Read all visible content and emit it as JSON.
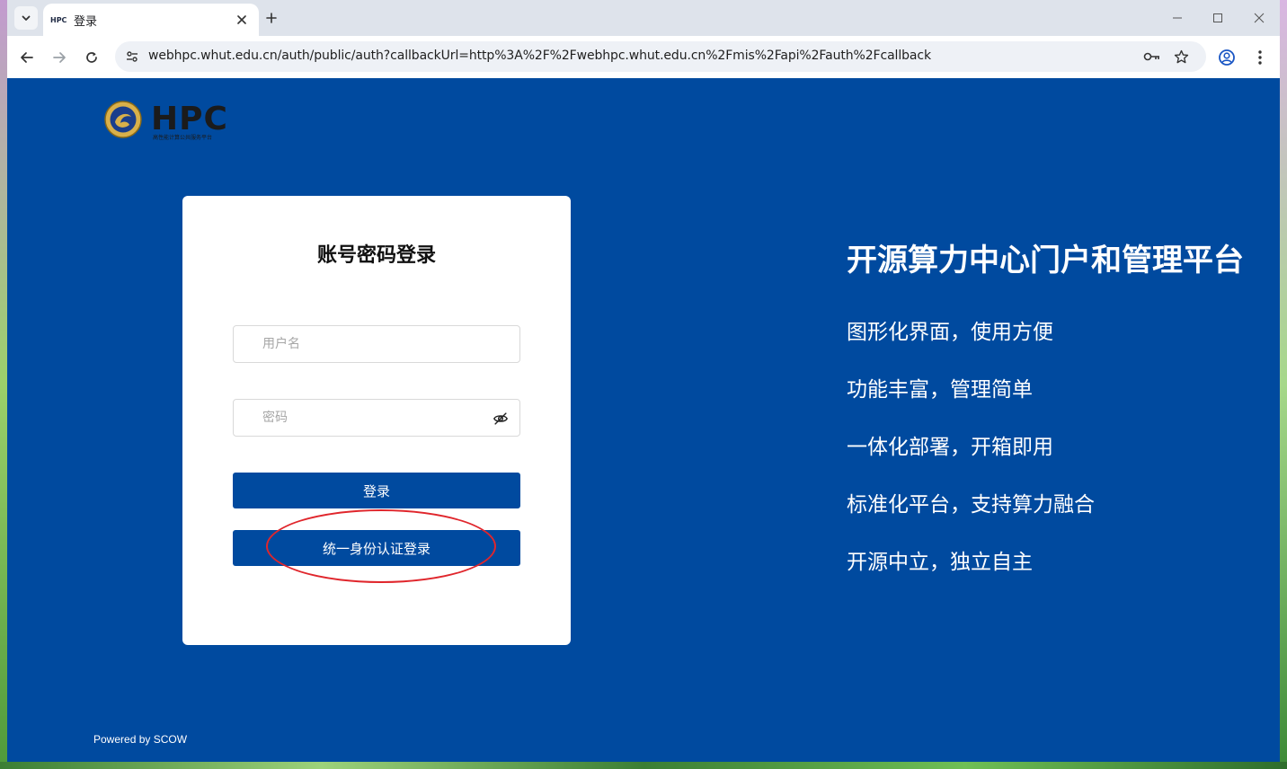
{
  "browser": {
    "tab": {
      "favicon_text": "HPC",
      "title": "登录"
    },
    "url": "webhpc.whut.edu.cn/auth/public/auth?callbackUrl=http%3A%2F%2Fwebhpc.whut.edu.cn%2Fmis%2Fapi%2Fauth%2Fcallback"
  },
  "page": {
    "logo": {
      "letters": "HPC",
      "subtitle": "高性能计算公共服务平台"
    },
    "login": {
      "title": "账号密码登录",
      "username_placeholder": "用户名",
      "password_placeholder": "密码",
      "login_button": "登录",
      "sso_button": "统一身份认证登录"
    },
    "features": {
      "title": "开源算力中心门户和管理平台",
      "items": [
        "图形化界面，使用方便",
        "功能丰富，管理简单",
        "一体化部署，开箱即用",
        "标准化平台，支持算力融合",
        "开源中立，独立自主"
      ]
    },
    "footer": "Powered by SCOW"
  },
  "colors": {
    "page_bg": "#004a9f",
    "button_bg": "#004a9f",
    "annotation_ellipse": "#e0262c"
  }
}
